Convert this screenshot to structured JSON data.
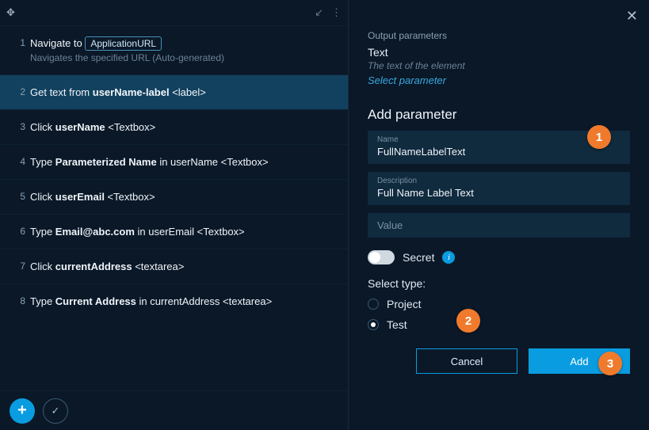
{
  "icons": {
    "move": "✥",
    "collapse": "↙",
    "more": "⋮",
    "close": "✕",
    "plus": "+",
    "check": "✓",
    "info": "i"
  },
  "steps": [
    {
      "num": "1",
      "prefix": "Navigate to ",
      "bold": "",
      "suffix": "",
      "chip": "ApplicationURL",
      "sub": "Navigates the specified URL (Auto-generated)",
      "selected": false
    },
    {
      "num": "2",
      "prefix": "Get text from ",
      "bold": "userName-label",
      "suffix": " <label>",
      "sub": "",
      "selected": true
    },
    {
      "num": "3",
      "prefix": "Click ",
      "bold": "userName",
      "suffix": " <Textbox>",
      "sub": "",
      "selected": false
    },
    {
      "num": "4",
      "prefix": "Type ",
      "bold": "Parameterized Name",
      "suffix": " in userName <Textbox>",
      "sub": "",
      "selected": false
    },
    {
      "num": "5",
      "prefix": "Click ",
      "bold": "userEmail",
      "suffix": " <Textbox>",
      "sub": "",
      "selected": false
    },
    {
      "num": "6",
      "prefix": "Type ",
      "bold": "Email@abc.com",
      "suffix": " in userEmail <Textbox>",
      "sub": "",
      "selected": false
    },
    {
      "num": "7",
      "prefix": "Click ",
      "bold": "currentAddress",
      "suffix": " <textarea>",
      "sub": "",
      "selected": false
    },
    {
      "num": "8",
      "prefix": "Type ",
      "bold": "Current Address",
      "suffix": " in currentAddress <textarea>",
      "sub": "",
      "selected": false
    }
  ],
  "right": {
    "output_parameters_label": "Output parameters",
    "output_text_title": "Text",
    "output_text_desc": "The text of the element",
    "select_parameter_link": "Select parameter",
    "add_parameter_title": "Add parameter",
    "name_label": "Name",
    "name_value": "FullNameLabelText",
    "desc_label": "Description",
    "desc_value": "Full Name Label Text",
    "value_placeholder": "Value",
    "secret_label": "Secret",
    "select_type_label": "Select type:",
    "type_project": "Project",
    "type_test": "Test",
    "cancel": "Cancel",
    "add": "Add"
  },
  "callouts": {
    "c1": "1",
    "c2": "2",
    "c3": "3"
  }
}
